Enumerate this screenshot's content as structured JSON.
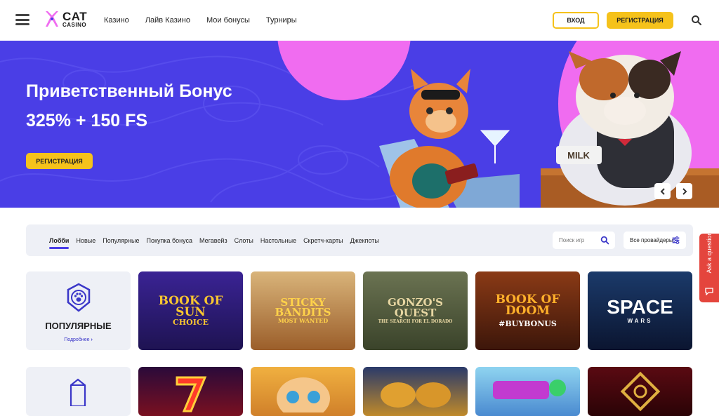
{
  "header": {
    "logo_cat": "CAT",
    "logo_casino": "CASINO",
    "nav": [
      "Казино",
      "Лайв Казино",
      "Мои бонусы",
      "Турниры"
    ],
    "login_label": "ВХОД",
    "register_label": "РЕГИСТРАЦИЯ"
  },
  "hero": {
    "title": "Приветственный Бонус",
    "subtitle": "325% + 150 FS",
    "button_label": "РЕГИСТРАЦИЯ",
    "sign_text": "MILK"
  },
  "filters": {
    "tabs": [
      "Лобби",
      "Новые",
      "Популярные",
      "Покупка бонуса",
      "Мегавейз",
      "Слоты",
      "Настольные",
      "Скретч-карты",
      "Джекпоты"
    ],
    "search_placeholder": "Поиск игр",
    "providers_label": "Все провайдеры"
  },
  "popular": {
    "title": "ПОПУЛЯРНЫЕ",
    "more_label": "Подробнее"
  },
  "games": [
    {
      "name": "BOOK OF SUN",
      "sub": "CHOICE",
      "bg": "#2a1a6e",
      "color": "#f7c531"
    },
    {
      "name": "STICKY BANDITS",
      "sub": "MOST WANTED",
      "bg": "#c88a3b",
      "color": "#ffd24a"
    },
    {
      "name": "GONZO'S QUEST",
      "sub": "THE SEARCH FOR EL DORADO",
      "bg": "#4d5a3a",
      "color": "#e8d7a3"
    },
    {
      "name": "BOOK OF DOOM",
      "sub": "#BUYBONUS",
      "bg": "#6b2b12",
      "color": "#ffb02a"
    },
    {
      "name": "SPACE",
      "sub": "WARS",
      "bg": "#11244a",
      "color": "#ffffff"
    }
  ],
  "ask_label": "Ask a question",
  "colors": {
    "brand": "#4a3ee6",
    "accent": "#f5c21b",
    "pink": "#f06cf0",
    "ask": "#e4453d"
  }
}
